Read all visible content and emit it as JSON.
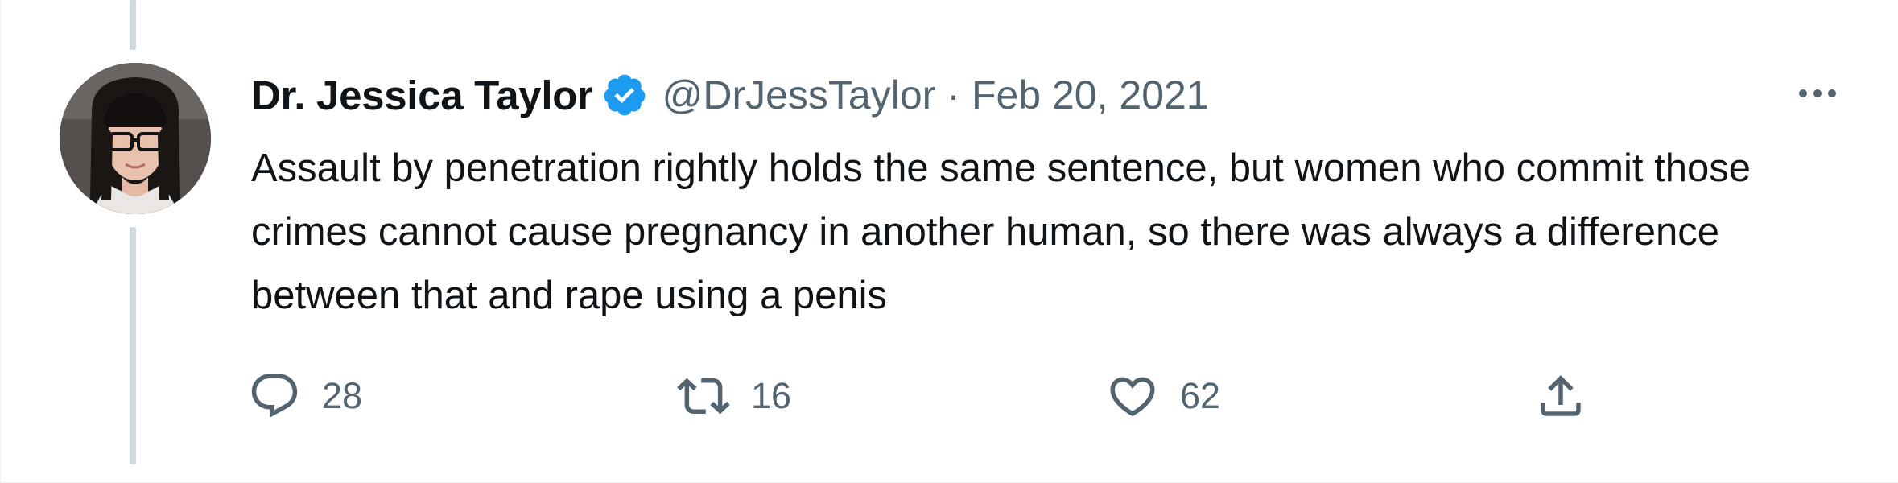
{
  "tweet": {
    "author": {
      "display_name": "Dr. Jessica Taylor",
      "handle": "@DrJessTaylor",
      "verified": true
    },
    "separator": "·",
    "date": "Feb 20, 2021",
    "text": "Assault by penetration rightly holds the same sentence, but women who commit those crimes cannot cause pregnancy in another human, so there was always a difference between that and rape using a penis",
    "actions": {
      "reply_count": "28",
      "retweet_count": "16",
      "like_count": "62"
    },
    "icons": {
      "reply": "reply-icon",
      "retweet": "retweet-icon",
      "like": "heart-icon",
      "share": "share-icon",
      "more": "more-options-icon",
      "verified": "verified-badge-icon"
    },
    "colors": {
      "text_primary": "#0f1419",
      "text_secondary": "#536471",
      "verified_blue": "#1d9bf0",
      "thread_line": "#cfd9de"
    }
  }
}
